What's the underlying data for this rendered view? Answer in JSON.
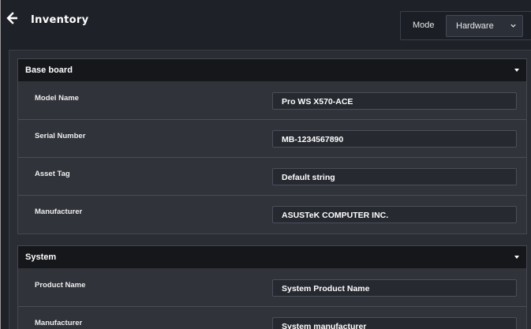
{
  "header": {
    "title": "Inventory",
    "mode_label": "Mode",
    "mode_value": "Hardware"
  },
  "sections": [
    {
      "title": "Base board",
      "rows": [
        {
          "label": "Model Name",
          "value": "Pro WS X570-ACE"
        },
        {
          "label": "Serial Number",
          "value": "MB-1234567890"
        },
        {
          "label": "Asset Tag",
          "value": "Default string"
        },
        {
          "label": "Manufacturer",
          "value": "ASUSTeK COMPUTER INC."
        }
      ]
    },
    {
      "title": "System",
      "rows": [
        {
          "label": "Product Name",
          "value": "System Product Name"
        },
        {
          "label": "Manufacturer",
          "value": "System manufacturer"
        }
      ]
    }
  ],
  "colors": {
    "background": "#1e2128",
    "panel": "#2a2d33",
    "section_header": "#15171b"
  },
  "icons": {
    "back": "arrow-left-icon",
    "mode_dropdown": "chevron-down-icon",
    "section_toggle": "caret-down-icon"
  }
}
